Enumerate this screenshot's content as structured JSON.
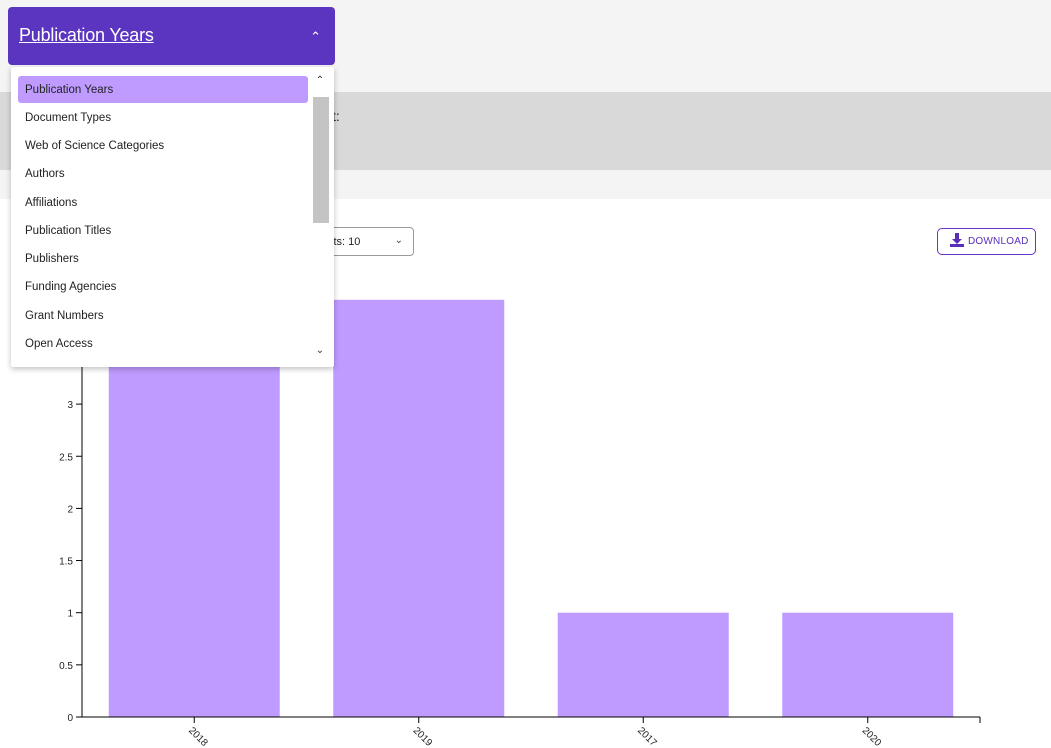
{
  "banner": {
    "text": "t:"
  },
  "results_select": {
    "label": "lts: 10"
  },
  "download": {
    "label": "DOWNLOAD"
  },
  "dropdown": {
    "selected_label": "Publication Years",
    "options": [
      "Publication Years",
      "Document Types",
      "Web of Science Categories",
      "Authors",
      "Affiliations",
      "Publication Titles",
      "Publishers",
      "Funding Agencies",
      "Grant Numbers",
      "Open Access"
    ]
  },
  "colors": {
    "accent": "#5b34c0",
    "bar": "#bf9bff",
    "selected_option": "#bf9bff"
  },
  "chart_data": {
    "type": "bar",
    "categories": [
      "2018",
      "2019",
      "2017",
      "2020"
    ],
    "values": [
      4,
      4,
      1,
      1
    ],
    "y_ticks": [
      "0",
      "0.5",
      "1",
      "1.5",
      "2",
      "2.5",
      "3"
    ],
    "ylim": [
      0,
      4
    ],
    "grid": false,
    "color": "#bf9bff"
  }
}
